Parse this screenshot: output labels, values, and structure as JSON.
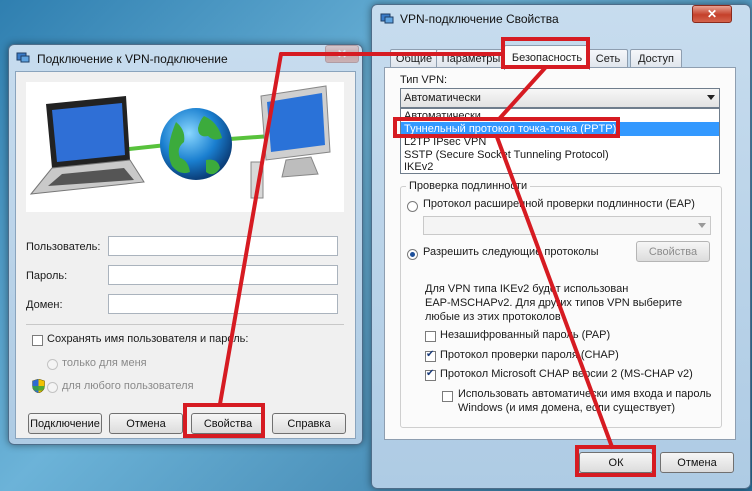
{
  "left_dialog": {
    "title": "Подключение к VPN-подключение",
    "close_symbol": "✕",
    "fields": {
      "user_label": "Пользователь:",
      "password_label": "Пароль:",
      "domain_label": "Домен:",
      "user_value": "",
      "password_value": "",
      "domain_value": ""
    },
    "save_checkbox": {
      "label": "Сохранять имя пользователя и пароль:",
      "checked": false
    },
    "radio_only_me": "только для меня",
    "radio_any_user": "для любого пользователя",
    "buttons": {
      "connect": "Подключение",
      "cancel": "Отмена",
      "properties": "Свойства",
      "help": "Справка"
    }
  },
  "right_dialog": {
    "title": "VPN-подключение Свойства",
    "close_symbol": "✕",
    "tabs": [
      "Общие",
      "Параметры",
      "Безопасность",
      "Сеть",
      "Доступ"
    ],
    "active_tab": "Безопасность",
    "vpn_type_label": "Тип VPN:",
    "vpn_type_selected": "Автоматически",
    "vpn_type_options": [
      "Автоматически",
      "Туннельный протокол точка-точка (PPTP)",
      "L2TP IPsec VPN",
      "SSTP (Secure Socket Tunneling Protocol)",
      "IKEv2"
    ],
    "auth_group_label": "Проверка подлинности",
    "eap_radio_label": "Протокол расширенной проверки подлинности (EAP)",
    "allow_radio_label": "Разрешить следующие протоколы",
    "properties_button": "Свойства",
    "info_text_1": "Для VPN типа IKEv2 будет использован",
    "info_text_2": "EAP-MSCHAPv2. Для других типов VPN выберите",
    "info_text_3": "любые из этих протоколов",
    "protocols": [
      {
        "label": "Незашифрованный пароль (PAP)",
        "checked": false
      },
      {
        "label": "Протокол проверки пароля (CHAP)",
        "checked": true
      },
      {
        "label": "Протокол Microsoft CHAP версии 2 (MS-CHAP v2)",
        "checked": true
      }
    ],
    "windows_login_label_1": "Использовать автоматически имя входа и пароль",
    "windows_login_label_2": "Windows (и имя домена, если существует)",
    "buttons": {
      "ok": "ОК",
      "cancel": "Отмена"
    }
  },
  "colors": {
    "annotation_red": "#d61b22",
    "selection_blue": "#3399ff"
  }
}
